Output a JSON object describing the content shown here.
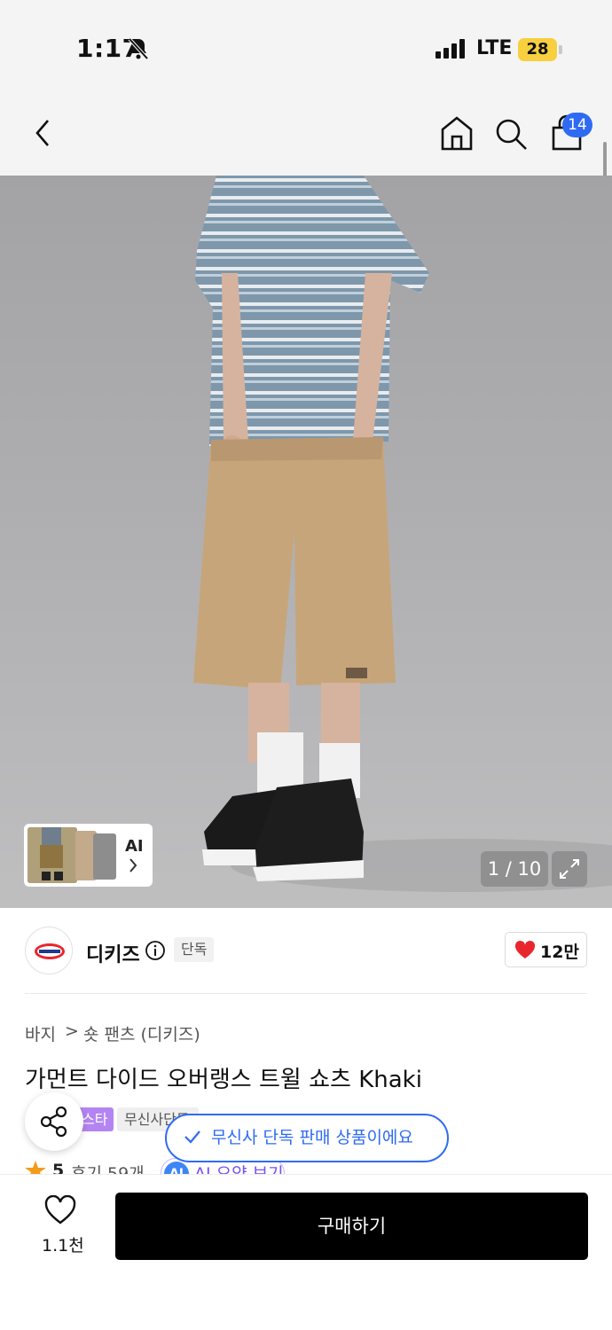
{
  "status_bar": {
    "time": "1:17",
    "network": "LTE",
    "battery": "28",
    "icons": [
      "bell-muted-icon",
      "signal-icon"
    ]
  },
  "nav": {
    "icons": [
      "back-icon",
      "home-icon",
      "search-icon",
      "cart-icon"
    ],
    "cart_count": "14"
  },
  "gallery": {
    "ai_label": "AI",
    "pager": "1 / 10",
    "icons": [
      "chevron-right-icon",
      "expand-icon"
    ]
  },
  "brand": {
    "name": "디키즈",
    "tag": "단독",
    "likes": "12만",
    "icons": [
      "info-icon",
      "heart-filled-icon"
    ]
  },
  "breadcrumb": {
    "category": "바지",
    "separator": ">",
    "subcategory": "숏 팬츠 (디키즈)"
  },
  "product": {
    "title": "가먼트 다이드 오버랭스 트윌 쇼츠 Khaki",
    "badge_purple": "스타",
    "badge_grey": "무신사단독",
    "rating": "5",
    "reviews": "후기 59개",
    "ai_circle": "AI",
    "ai_summary": "AI 요약 보기"
  },
  "toast": {
    "message": "무신사 단독 판매 상품이에요"
  },
  "bottom": {
    "wish_count": "1.1천",
    "buy_label": "구매하기"
  },
  "colors": {
    "accent_blue": "#2f6bf2",
    "heart_red": "#e8262d",
    "battery_yellow": "#f7cf3f",
    "purple_badge": "#b485f2"
  }
}
